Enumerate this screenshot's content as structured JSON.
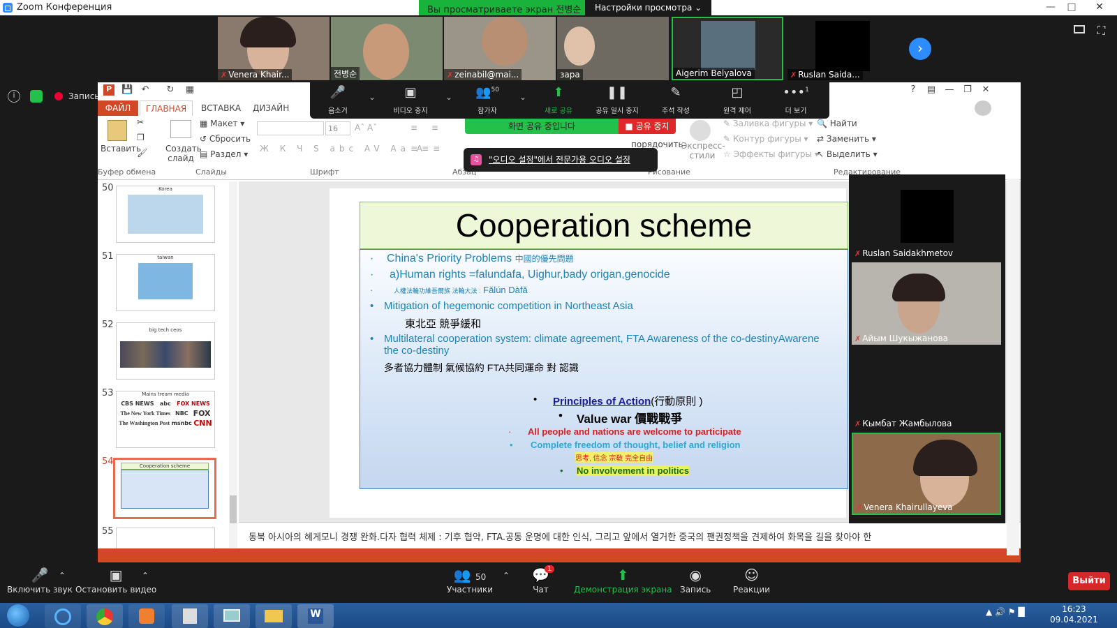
{
  "window": {
    "title": "Zoom Конференция",
    "viewing_banner": "Вы просматриваете экран 전병순",
    "view_options": "Настройки просмотра ⌄"
  },
  "participants_strip": [
    {
      "name": "Venera Khair..."
    },
    {
      "name": "전병순"
    },
    {
      "name": "zeinabil@mai..."
    },
    {
      "name": "зара"
    },
    {
      "name": "Aigerim Belyalova"
    },
    {
      "name": "Ruslan Saida..."
    }
  ],
  "recording": {
    "label": "Запись"
  },
  "ppt": {
    "tabs": [
      "ФАЙЛ",
      "ГЛАВНАЯ",
      "ВСТАВКА",
      "ДИЗАЙН"
    ],
    "ribbon": {
      "paste": "Вставить",
      "create_slide": "Создать слайд",
      "layout": "Макет",
      "reset": "Сбросить",
      "section": "Раздел",
      "font_size": "16",
      "arrange": "порядочить",
      "express_styles": "Экспресс-стили",
      "fill": "Заливка фигуры",
      "outline": "Контур фигуры",
      "effects": "Эффекты фигуры",
      "find": "Найти",
      "replace": "Заменить",
      "select": "Выделить",
      "groups": {
        "clipboard": "Буфер обмена",
        "slides": "Слайды",
        "font": "Шрифт",
        "paragraph": "Абзац",
        "drawing": "Рисование",
        "editing": "Редактирование"
      }
    },
    "slides": [
      {
        "num": "50",
        "title": "Korea"
      },
      {
        "num": "51",
        "title": "taiwan"
      },
      {
        "num": "52",
        "title": "big tech ceos"
      },
      {
        "num": "53",
        "title": "Mains tream media"
      },
      {
        "num": "54",
        "title": "Cooperation scheme"
      },
      {
        "num": "55",
        "title": ""
      }
    ],
    "media_logos": [
      "CBS NEWS",
      "abc",
      "FOX NEWS",
      "The New York Times",
      "NBC",
      "FOX",
      "The Washington Post",
      "msnbc",
      "CNN"
    ],
    "current_slide": {
      "title": "Cooperation scheme",
      "line1": "China's Priority Problems",
      "line1_cjk": "中國的優先問題",
      "line2": "a)Human rights =falundafa, Uighur,bady origan,genocide",
      "line3_cjk": "人權法輪功維吾爾族  法輪大法 :",
      "line3_latin": "Fǎlún Dàfǎ",
      "line4": "Mitigation of hegemonic competition in Northeast Asia",
      "line5": "東北亞  競爭緩和",
      "line6": "Multilateral cooperation system: climate agreement, FTA Awareness of the co-destinyAwarene",
      "line6b": "the co-destiny",
      "line7": "多者協力體制  氣候協約  FTA共同運命  對  認識",
      "principles": "Principles of Action",
      "principles_cjk": "(行動原則 )",
      "value_war": "Value war 價戰戰爭",
      "item1": "All people and nations are welcome to participate",
      "item2": "Complete freedom of thought, belief and religion",
      "item2_cjk": "思考, 信念   宗敎  完全自由",
      "item3": "No involvement in politics"
    },
    "notes": "동북 아시아의 헤게모니 경쟁 완화.다자 협력 체제 : 기후 협약, FTA.공동 운명에 대한 인식, 그리고 앞에서 열거한 중국의 팬권정책을  견제하여 화목을 길을 찾아야 한"
  },
  "zoom_toolbar": {
    "items": [
      {
        "label": "음소거",
        "icon": "mic-icon"
      },
      {
        "label": "비디오 중지",
        "icon": "camera-icon"
      },
      {
        "label": "참가자",
        "icon": "participants-icon",
        "count": "50"
      },
      {
        "label": "새로 공유",
        "icon": "share-icon"
      },
      {
        "label": "공유 일시 중지",
        "icon": "pause-icon"
      },
      {
        "label": "주석 작성",
        "icon": "pen-icon"
      },
      {
        "label": "원격 제어",
        "icon": "mouse-icon"
      },
      {
        "label": "더 보기",
        "icon": "more-icon"
      }
    ],
    "more_badge": "1",
    "sharing_banner": "화면 공유 중입니다",
    "stop_share": "공유 중지",
    "notification": "\"오디오 설정\"에서 전문가용 오디오 설정"
  },
  "speakers": [
    {
      "name": "Ruslan Saidakhmetov"
    },
    {
      "name": "Айым Шукыжанова"
    },
    {
      "name": "Кымбат Жамбылова"
    },
    {
      "name": "Venera Khairullayeva"
    }
  ],
  "bottom_bar": {
    "unmute": "Включить звук",
    "stop_video": "Остановить видео",
    "participants": "Участники",
    "participants_count": "50",
    "chat": "Чат",
    "chat_badge": "1",
    "share_screen": "Демонстрация экрана",
    "record": "Запись",
    "reactions": "Реакции",
    "leave": "Выйти"
  },
  "taskbar": {
    "time": "16:23",
    "date": "09.04.2021"
  },
  "colors": {
    "zoom_green": "#23c14a",
    "zoom_blue": "#2d8cff",
    "ppt_orange": "#d24726",
    "stop_red": "#e02828"
  }
}
